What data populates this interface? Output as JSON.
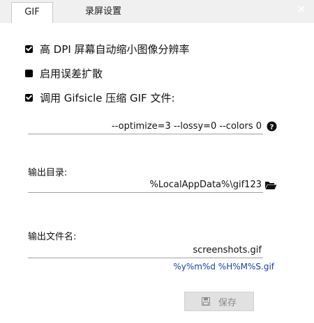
{
  "tabs": [
    {
      "label": "GIF"
    },
    {
      "label": "录屏设置"
    }
  ],
  "window": {
    "close_icon": "close-icon"
  },
  "options": [
    {
      "label": "高 DPI 屏幕自动缩小图像分辨率",
      "checked": true
    },
    {
      "label": "启用误差扩散",
      "checked": false
    },
    {
      "label": "调用 Gifsicle 压缩 GIF 文件:",
      "checked": true
    }
  ],
  "gifsicle": {
    "args_value": "--optimize=3 --lossy=0 --colors 0",
    "icon": "help-icon"
  },
  "output_dir": {
    "label": "输出目录:",
    "value": "%LocalAppData%\\gif123",
    "icon": "folder-open-icon"
  },
  "output_file": {
    "label": "输出文件名:",
    "value": "screenshots.gif",
    "hint": "%y%m%d %H%M%S.gif"
  },
  "save_button": {
    "label": "保存",
    "icon": "floppy-disk-icon"
  }
}
